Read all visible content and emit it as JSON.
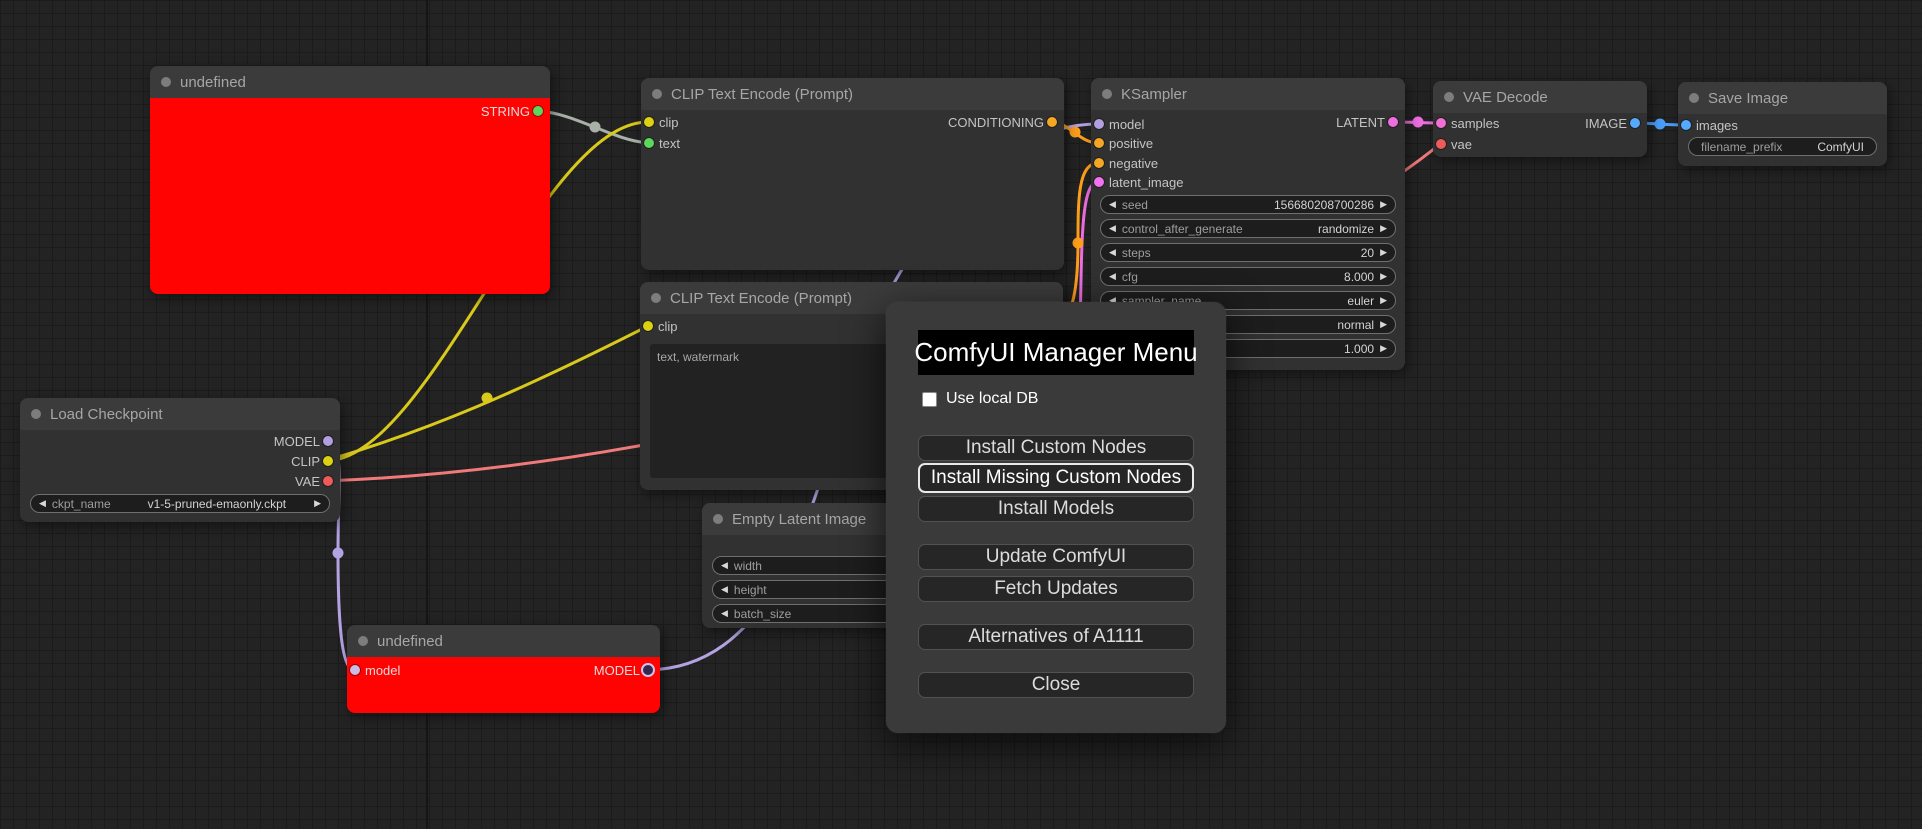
{
  "colors": {
    "canvas_bg": "#232323",
    "grid_line": "#1b1b1b",
    "node_bg": "#313131",
    "node_header": "#3b3b3b",
    "error_red": "#ff0202",
    "dialog_bg": "#3a3a3a",
    "button_bg": "#262626",
    "wire_yellow": "#d9c91a",
    "wire_salmon": "#f07a7a",
    "wire_purple": "#b4a3e3",
    "wire_orange": "#ff9f1c",
    "wire_pink": "#ee6ee0",
    "wire_blue": "#4a9df8",
    "wire_gray": "#a8b0a8"
  },
  "nodes": {
    "undefined_top": {
      "title": "undefined",
      "output_label": "STRING"
    },
    "clip_encode_top": {
      "title": "CLIP Text Encode (Prompt)",
      "input_clip": "clip",
      "input_text": "text",
      "output_label": "CONDITIONING"
    },
    "ksampler": {
      "title": "KSampler",
      "input_model": "model",
      "input_positive": "positive",
      "input_negative": "negative",
      "input_latent": "latent_image",
      "output_label": "LATENT",
      "widgets": [
        {
          "label": "seed",
          "value": "156680208700286"
        },
        {
          "label": "control_after_generate",
          "value": "randomize"
        },
        {
          "label": "steps",
          "value": "20"
        },
        {
          "label": "cfg",
          "value": "8.000"
        },
        {
          "label": "sampler_name",
          "value": "euler"
        },
        {
          "label": "",
          "value": "normal"
        },
        {
          "label": "",
          "value": "1.000"
        }
      ]
    },
    "vae_decode": {
      "title": "VAE Decode",
      "input_samples": "samples",
      "input_vae": "vae",
      "output_label": "IMAGE"
    },
    "save_image": {
      "title": "Save Image",
      "input_images": "images",
      "widget": {
        "label": "filename_prefix",
        "value": "ComfyUI"
      }
    },
    "load_checkpoint": {
      "title": "Load Checkpoint",
      "output_model": "MODEL",
      "output_clip": "CLIP",
      "output_vae": "VAE",
      "widget": {
        "label": "ckpt_name",
        "value": "v1-5-pruned-emaonly.ckpt"
      }
    },
    "clip_encode_bottom": {
      "title": "CLIP Text Encode (Prompt)",
      "input_clip": "clip",
      "prompt_text": "text, watermark"
    },
    "empty_latent": {
      "title": "Empty Latent Image",
      "widgets": [
        {
          "label": "width"
        },
        {
          "label": "height"
        },
        {
          "label": "batch_size"
        }
      ]
    },
    "undefined_bottom": {
      "title": "undefined",
      "input_model": "model",
      "output_label": "MODEL"
    }
  },
  "dialog": {
    "title": "ComfyUI Manager Menu",
    "checkbox_label": "Use local DB",
    "buttons": [
      "Install Custom Nodes",
      "Install Missing Custom Nodes",
      "Install Models",
      "Update ComfyUI",
      "Fetch Updates",
      "Alternatives of A1111",
      "Close"
    ]
  }
}
